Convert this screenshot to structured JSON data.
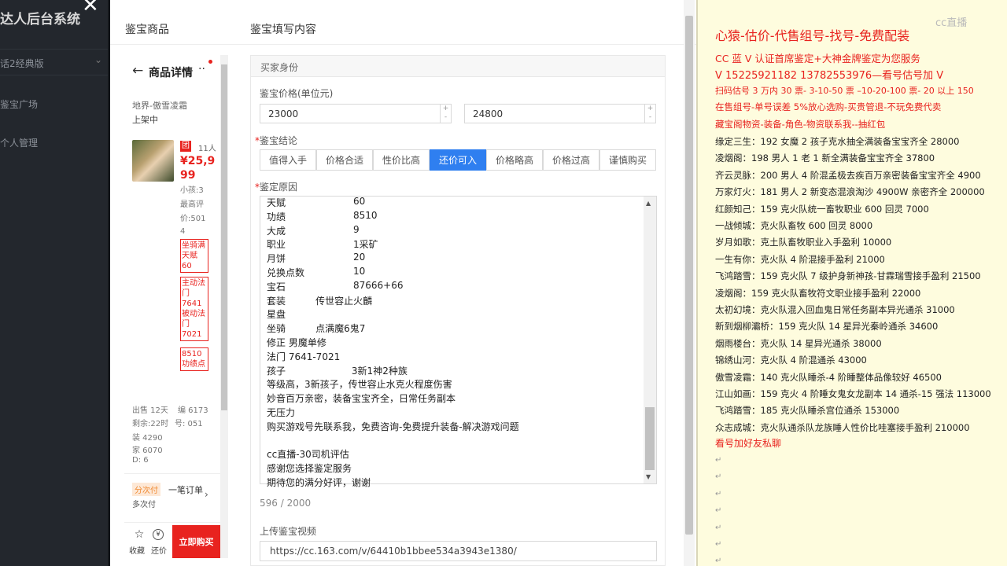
{
  "bg_title": "达人后台系统",
  "left_menu": {
    "version": "话2经典版",
    "item1": "鉴宝广场",
    "item2": "个人管理"
  },
  "modal": {
    "left_header": "鉴宝商品",
    "right_header": "鉴宝填写内容",
    "product": {
      "title": "商品详情",
      "server": "地界-傲雪凌霜",
      "status": "上架中",
      "badge": "团",
      "people": "11人",
      "price": "¥25,999",
      "child_stat": "小孩:3",
      "highest_label": "最高评",
      "price_val": "价:501",
      "price_val2": "4",
      "tags": [
        "坐骑满天赋60",
        "主动法门7641 被动法门7021",
        "8510功绩点"
      ],
      "stats": [
        "出售 12天",
        "编 6173",
        "剩余:22时",
        "号: 051",
        "装 4290",
        "家 6070",
        "D: 6"
      ],
      "installment": "分次付",
      "one_order": "一笔订单",
      "multi_pay": "多次付",
      "fav": "收藏",
      "bargain": "还价",
      "buy": "立即购买"
    },
    "section_title": "买家身份",
    "price_label": "鉴宝价格(单位元)",
    "price_min": "23000",
    "price_max": "24800",
    "conclusion_label": "鉴宝结论",
    "options": [
      "值得入手",
      "价格合适",
      "性价比高",
      "还价可入",
      "价格略高",
      "价格过高",
      "谨慎购买"
    ],
    "reason_label": "鉴定原因",
    "reason_lines": [
      {
        "k": "天赋",
        "v": "60"
      },
      {
        "k": "功绩",
        "v": "8510"
      },
      {
        "k": "大成",
        "v": "9"
      },
      {
        "k": "职业",
        "v": "1采矿"
      },
      {
        "k": "月饼",
        "v": "20"
      },
      {
        "k": "兑换点数",
        "v": "10"
      },
      {
        "k": "宝石",
        "v": "87666+66"
      }
    ],
    "reason_lines2": [
      "套装          传世容止火麟",
      "星盘",
      "坐骑          点满魔6鬼7",
      "修正 男魔单修",
      "法门 7641-7021",
      "孩子                      3新1神2种族",
      "等级高，3新孩子，传世容止水克火程度伤害",
      "妙音百万亲密，装备宝宝齐全，日常任务副本",
      "无压力",
      "购买游戏号先联系我，免费咨询-免费提升装备-解决游戏问题",
      "",
      "cc直播-30司机评估",
      "感谢您选择鉴定服务",
      "期待您的满分好评，谢谢"
    ],
    "char_count": "596 / 2000",
    "upload_label": "上传鉴宝视频",
    "video_url": "https://cc.163.com/v/64410b1bbee534a3943e1380/"
  },
  "notepad": {
    "title": "心猿-估价-代售组号-找号-免费配装",
    "lines_red": [
      "CC 蓝 V 认证首席鉴定+大神金牌鉴定为您服务",
      "V 15225921182     13782553976—看号估号加 V",
      "扫码估号 3 万内 30 票- 3-10-50 票  –10-20-100 票- 20 以上 150",
      "在售组号-单号误差 5%放心选购-买贵管退-不玩免费代卖",
      "藏宝阁物资-装备-角色-物资联系我--抽红包"
    ],
    "lines": [
      "缘定三生：192 女魔 2 孩子克水抽全满装备宝宝齐全 28000",
      "凌烟阁：198 男人 1 老 1 新全满装备宝宝齐全 37800",
      "齐云灵脉：200 男人 4 阶混孟极去疾百万亲密装备宝宝齐全 4900",
      "万家灯火：181 男人 2 新变态混浪淘沙 4900W 亲密齐全 200000",
      "红颜知己：159 克火队统一畜牧职业 600 回灵 7000",
      "一战倾城：克火队畜牧 600 回灵 8000",
      "岁月如歌：克土队畜牧职业入手盈利 10000",
      "一生有你：克火队 4 阶混接手盈利 21000",
      "飞鸿踏雪：159 克火队 7 级护身新神孩-甘霖瑞雪接手盈利 21500",
      "凌烟阁：159 克火队畜牧符文职业接手盈利 22000",
      "太初幻境：克火队混入回血鬼日常任务副本异光通杀 31000",
      "新到烟柳灞桥：159 克火队 14 星异光秦岭通杀 34600",
      "烟雨楼台：克火队 14 星异光通杀 38000",
      "锦绣山河：克火队 4 阶混通杀 43000",
      "傲雪凌霜：140 克火队睡杀-4 阶睡整体品像较好 46500",
      "江山如画：159 克火 4 阶睡女鬼女龙副本 14 通杀-15 强法 113000",
      "飞鸿踏雪：185 克火队睡杀宫位通杀 153000",
      "众志成城：克火队通杀队龙族睡人性价比哇塞接手盈利 210000"
    ],
    "footer": "看号加好友私聊"
  },
  "watermark": "cc直播",
  "colors": {
    "accent": "#2f7ff0",
    "buy": "#e8231f",
    "red_text": "#e8231f"
  }
}
